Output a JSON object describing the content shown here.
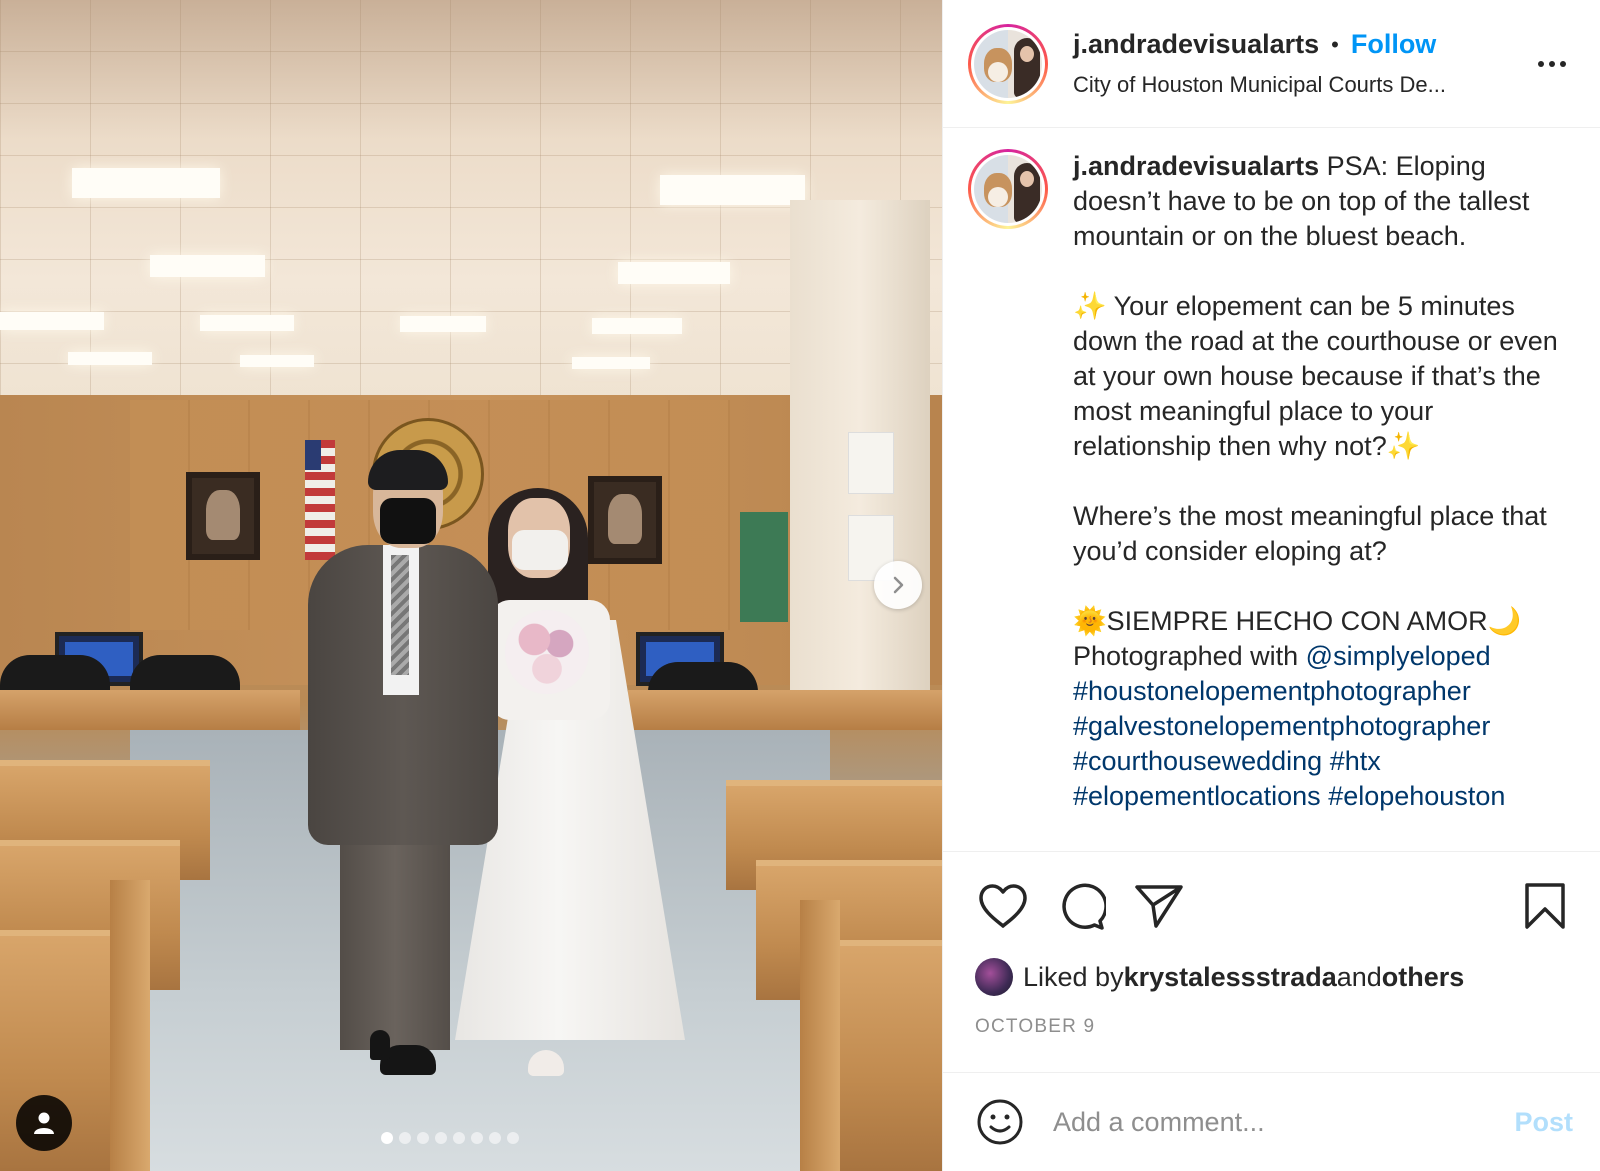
{
  "post": {
    "username": "j.andradevisualarts",
    "follow_label": "Follow",
    "bullet": "•",
    "location": "City of Houston Municipal Courts De...",
    "more_icon": "more-horizontal-icon"
  },
  "caption": {
    "username": "j.andradevisualarts",
    "paragraph1": " PSA: Eloping doesn’t have to be on top of the tallest mountain or on the bluest beach.",
    "sparkle_open": "✨",
    "paragraph2": " Your elopement can be 5 minutes down the road at the courthouse or even at your own house because if that’s the most meaningful place to your relationship then why not?",
    "sparkle_close": "✨",
    "paragraph3": "Where’s the most meaningful place that you’d consider eloping at?",
    "sun_emoji": "🌞",
    "motto": "SIEMPRE HECHO CON AMOR",
    "moon_emoji": "🌙",
    "photographed_prefix": "Photographed with ",
    "mention": "@simplyeloped",
    "hashtags": [
      "#houstonelopementphotographer",
      "#galvestonelopementphotographer",
      "#courthousewedding",
      "#htx",
      "#elopementlocations",
      "#elopehouston"
    ]
  },
  "actions": {
    "like_icon": "heart-icon",
    "comment_icon": "comment-icon",
    "share_icon": "send-icon",
    "save_icon": "bookmark-icon"
  },
  "likes": {
    "prefix": "Liked by ",
    "liker": "krystalessstrada",
    "middle": " and ",
    "others": "others"
  },
  "date": "OCTOBER 9",
  "comment": {
    "placeholder": "Add a comment...",
    "post_label": "Post"
  },
  "carousel": {
    "total_slides": 8,
    "active_slide": 1
  },
  "colors": {
    "accent": "#0095f6",
    "link": "#00376b",
    "muted": "#8e8e8e",
    "post_disabled": "#b2dffc"
  }
}
